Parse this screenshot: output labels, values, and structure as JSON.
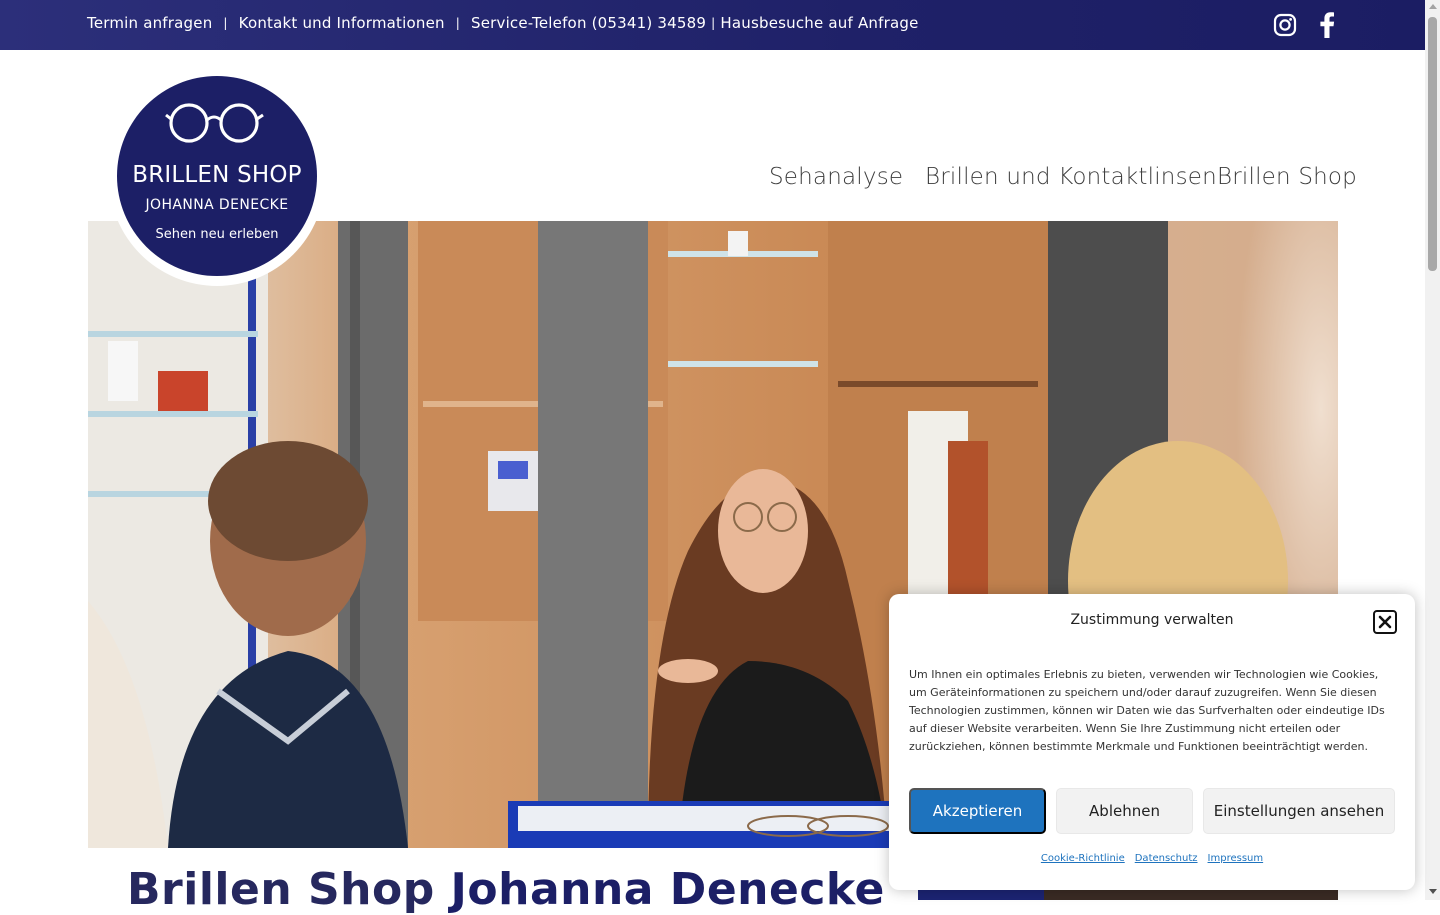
{
  "topbar": {
    "links": [
      "Termin anfragen",
      "Kontakt und Informationen",
      "Service-Telefon (05341) 34589",
      "Hausbesuche auf Anfrage"
    ],
    "separator": "|",
    "social_icons": [
      "instagram-icon",
      "facebook-icon"
    ]
  },
  "logo": {
    "title": "BRILLEN SHOP",
    "subtitle": "JOHANNA DENECKE",
    "tagline": "Sehen neu erleben",
    "icon": "glasses-icon"
  },
  "nav": {
    "items": [
      "Sehanalyse",
      "Brillen und Kontaktlinsen",
      "Brillen Shop"
    ]
  },
  "headline": {
    "prefix": "Brillen Shop ",
    "bold": "Johanna Denecke"
  },
  "cookie_banner": {
    "title": "Zustimmung verwalten",
    "text": "Um Ihnen ein optimales Erlebnis zu bieten, verwenden wir Technologien wie Cookies, um Geräteinformationen zu speichern und/oder darauf zuzugreifen. Wenn Sie diesen Technologien zustimmen, können wir Daten wie das Surfverhalten oder eindeutige IDs auf dieser Website verarbeiten. Wenn Sie Ihre Zustimmung nicht erteilen oder zurückziehen, können bestimmte Merkmale und Funktionen beeinträchtigt werden.",
    "accept_label": "Akzeptieren",
    "deny_label": "Ablehnen",
    "settings_label": "Einstellungen ansehen",
    "links": [
      "Cookie-Richtlinie",
      "Datenschutz",
      "Impressum"
    ]
  },
  "colors": {
    "brand_navy": "#1c1f66",
    "accept_blue": "#1e73be"
  }
}
